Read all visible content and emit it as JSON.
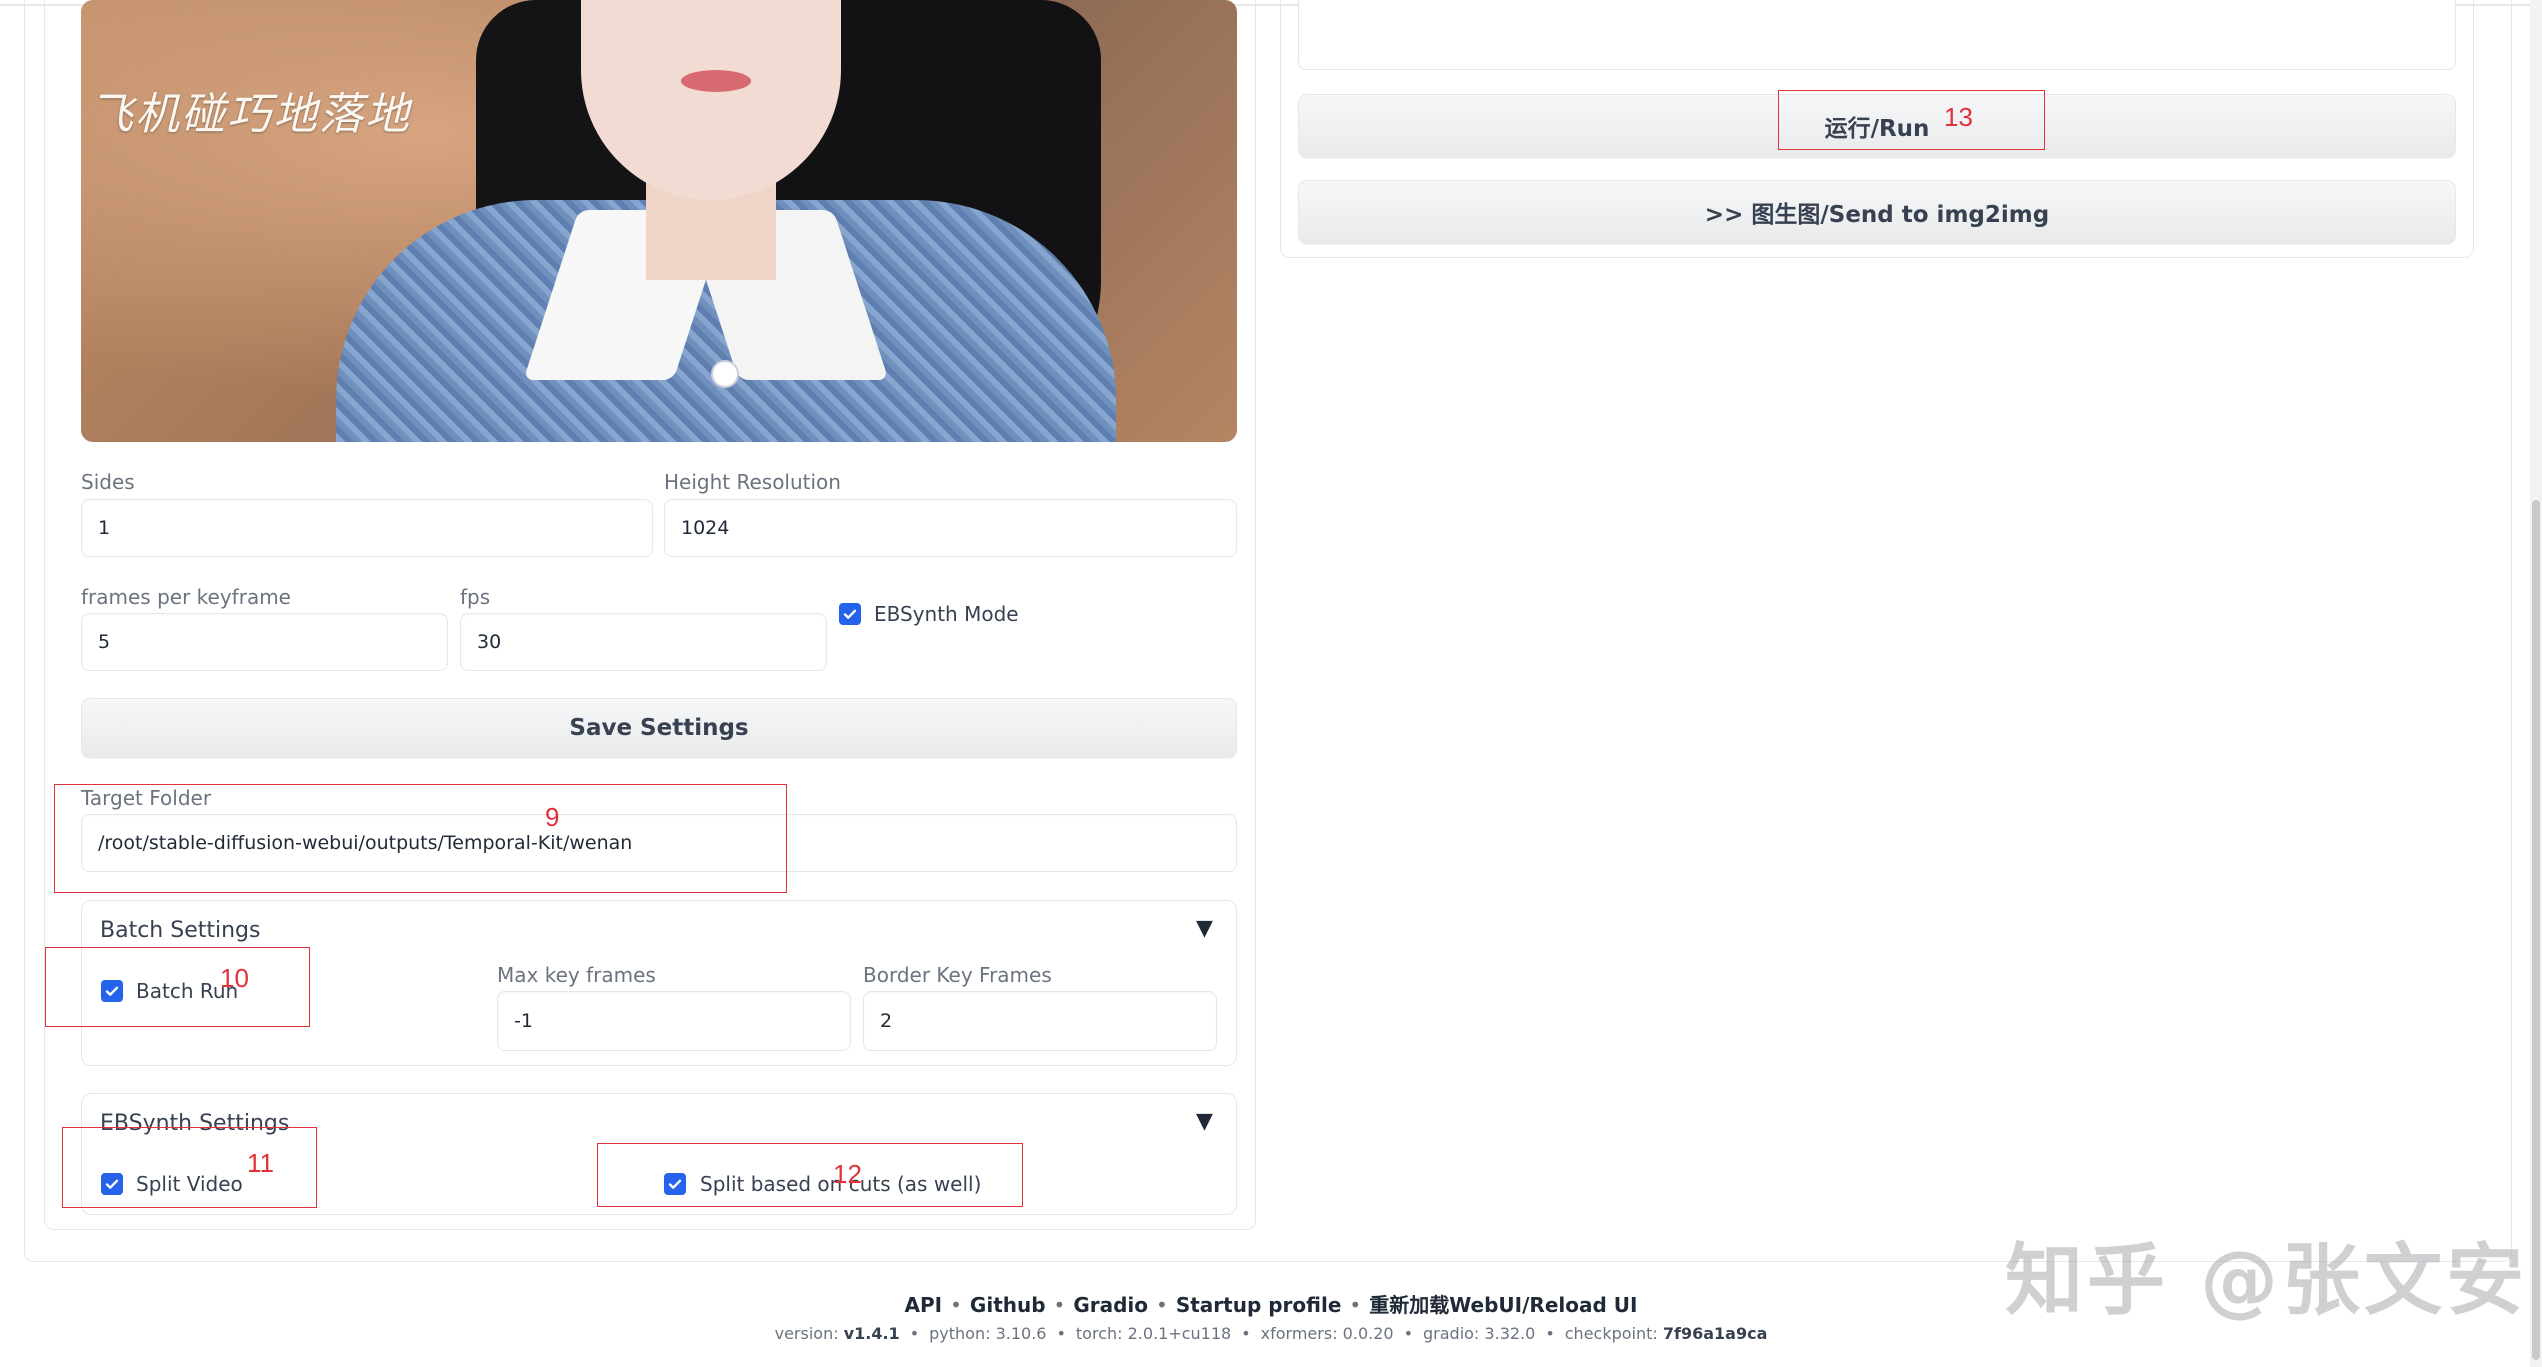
{
  "preview": {
    "overlay_text": "飞机碰巧地落地"
  },
  "fields": {
    "sides": {
      "label": "Sides",
      "value": "1"
    },
    "height_resolution": {
      "label": "Height Resolution",
      "value": "1024"
    },
    "frames_per_keyframe": {
      "label": "frames per keyframe",
      "value": "5"
    },
    "fps": {
      "label": "fps",
      "value": "30"
    },
    "ebsynth_mode": {
      "label": "EBSynth Mode",
      "checked": true
    },
    "target_folder": {
      "label": "Target Folder",
      "value": "/root/stable-diffusion-webui/outputs/Temporal-Kit/wenan"
    }
  },
  "buttons": {
    "save_settings": "Save Settings",
    "run": "运行/Run",
    "send_to_img2img": ">> 图生图/Send to img2img"
  },
  "batch_settings": {
    "title": "Batch Settings",
    "batch_run": {
      "label": "Batch Run",
      "checked": true
    },
    "max_key_frames": {
      "label": "Max key frames",
      "value": "-1"
    },
    "border_key_frames": {
      "label": "Border Key Frames",
      "value": "2"
    }
  },
  "ebsynth_settings": {
    "title": "EBSynth Settings",
    "split_video": {
      "label": "Split Video",
      "checked": true
    },
    "split_based_on_cuts": {
      "label": "Split based on cuts (as well)",
      "checked": true
    }
  },
  "annotations": [
    "9",
    "10",
    "11",
    "12",
    "13"
  ],
  "footer": {
    "links": [
      "API",
      "Github",
      "Gradio",
      "Startup profile",
      "重新加载WebUI/Reload UI"
    ],
    "version_items": [
      {
        "key": "version:",
        "value": "v1.4.1",
        "bold": true
      },
      {
        "key": "python:",
        "value": "3.10.6",
        "bold": false
      },
      {
        "key": "torch:",
        "value": "2.0.1+cu118",
        "bold": false
      },
      {
        "key": "xformers:",
        "value": "0.0.20",
        "bold": false
      },
      {
        "key": "gradio:",
        "value": "3.32.0",
        "bold": false
      },
      {
        "key": "checkpoint:",
        "value": "7f96a1a9ca",
        "bold": true
      }
    ]
  },
  "watermark": "知乎 @张文安",
  "colors": {
    "accent": "#2563eb",
    "annotation_red": "#e3303a"
  }
}
